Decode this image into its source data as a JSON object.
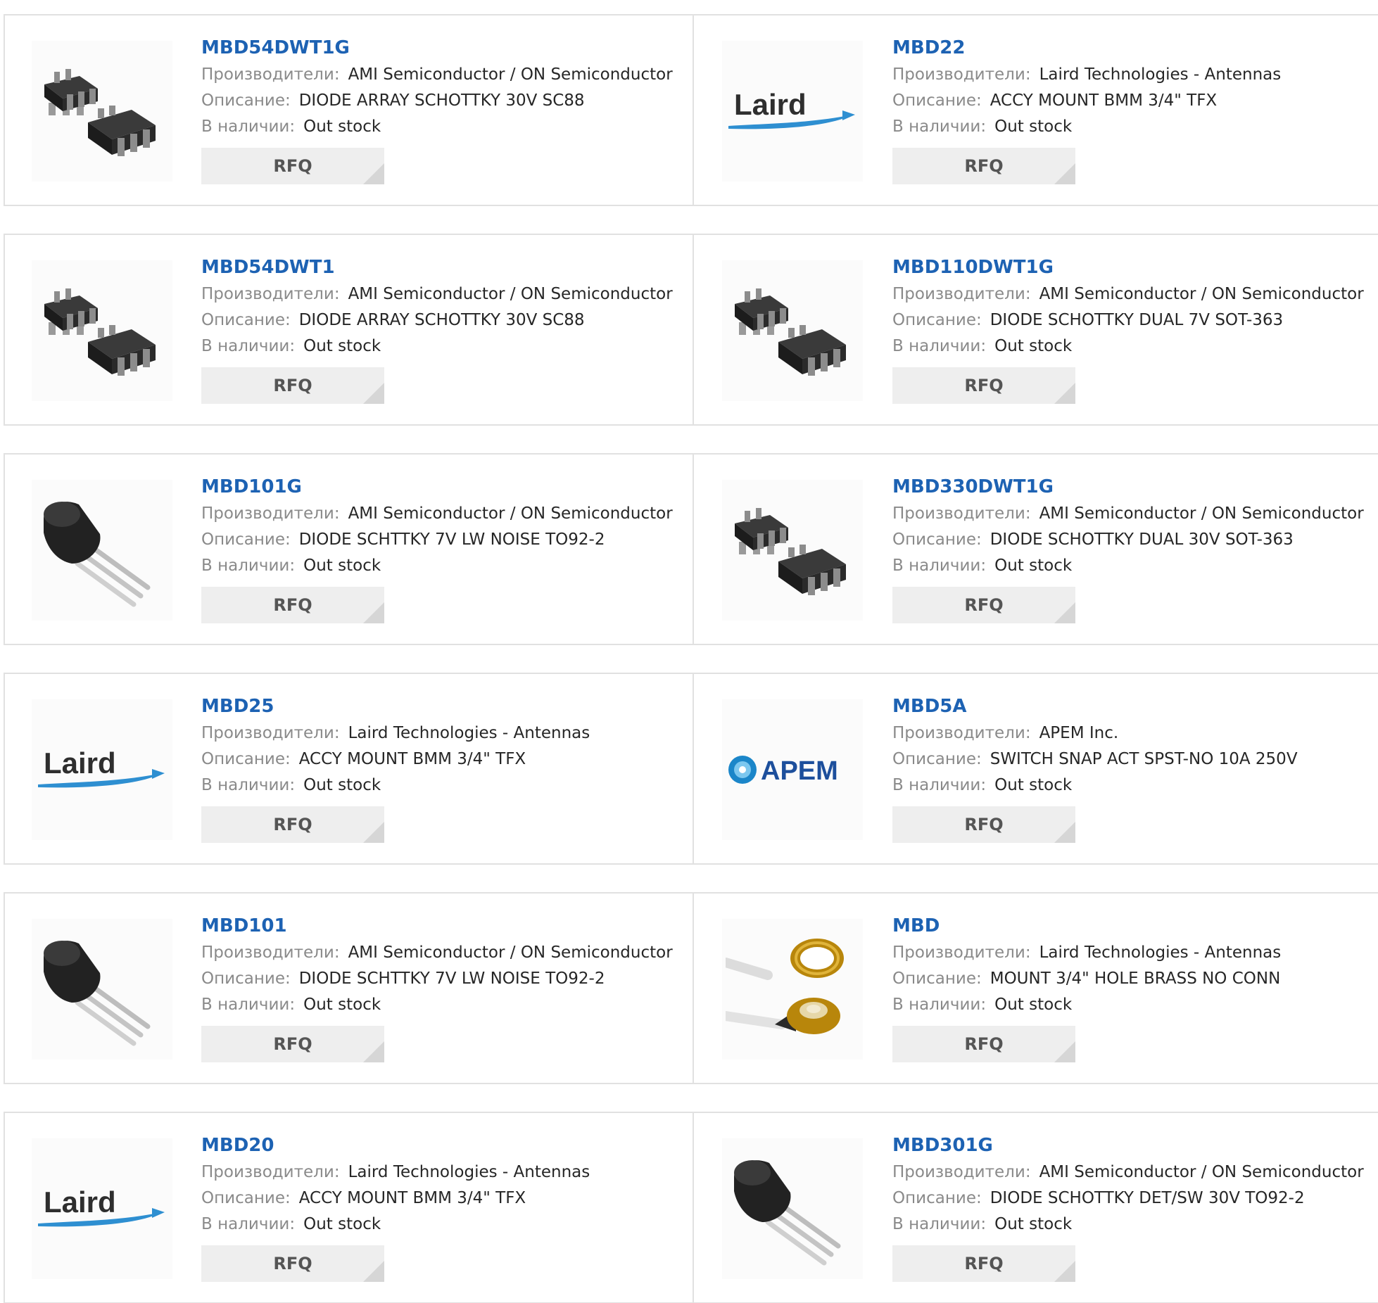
{
  "labels": {
    "manufacturer": "Производители:",
    "description": "Описание:",
    "stock": "В наличии:",
    "rfq": "RFQ"
  },
  "colors": {
    "part_link": "#1d62b3",
    "label": "#8a8a8a",
    "value": "#262626",
    "button_bg": "#eeeeee",
    "border": "#e1e1e1"
  },
  "products": [
    {
      "part": "MBD54DWT1G",
      "manufacturer": "AMI Semiconductor / ON Semiconductor",
      "description": "DIODE ARRAY SCHOTTKY 30V SC88",
      "stock": "Out stock",
      "image": "sot363-icon"
    },
    {
      "part": "MBD22",
      "manufacturer": "Laird Technologies - Antennas",
      "description": "ACCY MOUNT BMM 3/4\" TFX",
      "stock": "Out stock",
      "image": "laird-logo",
      "logo_text": "Laird"
    },
    {
      "part": "MBD54DWT1",
      "manufacturer": "AMI Semiconductor / ON Semiconductor",
      "description": "DIODE ARRAY SCHOTTKY 30V SC88",
      "stock": "Out stock",
      "image": "sot363-icon"
    },
    {
      "part": "MBD110DWT1G",
      "manufacturer": "AMI Semiconductor / ON Semiconductor",
      "description": "DIODE SCHOTTKY DUAL 7V SOT-363",
      "stock": "Out stock",
      "image": "sot363-icon"
    },
    {
      "part": "MBD101G",
      "manufacturer": "AMI Semiconductor / ON Semiconductor",
      "description": "DIODE SCHTTKY 7V LW NOISE TO92-2",
      "stock": "Out stock",
      "image": "to92-icon"
    },
    {
      "part": "MBD330DWT1G",
      "manufacturer": "AMI Semiconductor / ON Semiconductor",
      "description": "DIODE SCHOTTKY DUAL 30V SOT-363",
      "stock": "Out stock",
      "image": "sot363-icon"
    },
    {
      "part": "MBD25",
      "manufacturer": "Laird Technologies - Antennas",
      "description": "ACCY MOUNT BMM 3/4\" TFX",
      "stock": "Out stock",
      "image": "laird-logo",
      "logo_text": "Laird"
    },
    {
      "part": "MBD5A",
      "manufacturer": "APEM Inc.",
      "description": "SWITCH SNAP ACT SPST-NO 10A 250V",
      "stock": "Out stock",
      "image": "apem-logo",
      "logo_text": "APEM"
    },
    {
      "part": "MBD101",
      "manufacturer": "AMI Semiconductor / ON Semiconductor",
      "description": "DIODE SCHTTKY 7V LW NOISE TO92-2",
      "stock": "Out stock",
      "image": "to92-icon"
    },
    {
      "part": "MBD",
      "manufacturer": "Laird Technologies - Antennas",
      "description": "MOUNT 3/4\" HOLE BRASS NO CONN",
      "stock": "Out stock",
      "image": "brass-mount-icon"
    },
    {
      "part": "MBD20",
      "manufacturer": "Laird Technologies - Antennas",
      "description": "ACCY MOUNT BMM 3/4\" TFX",
      "stock": "Out stock",
      "image": "laird-logo",
      "logo_text": "Laird"
    },
    {
      "part": "MBD301G",
      "manufacturer": "AMI Semiconductor / ON Semiconductor",
      "description": "DIODE SCHOTTKY DET/SW 30V TO92-2",
      "stock": "Out stock",
      "image": "to92-icon"
    }
  ]
}
